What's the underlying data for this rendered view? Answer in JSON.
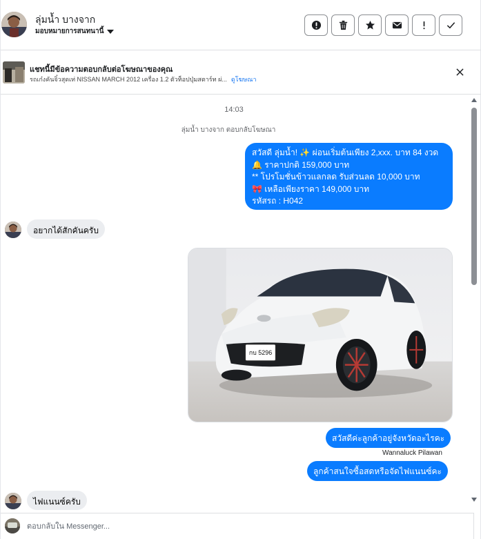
{
  "header": {
    "contact_name": "ลุ่มน้ำ บางจาก",
    "contact_subtitle": "มอบหมายการสนทนานี้",
    "actions": [
      {
        "name": "report-button",
        "icon": "alert-circle-icon"
      },
      {
        "name": "delete-button",
        "icon": "trash-icon"
      },
      {
        "name": "star-button",
        "icon": "star-icon"
      },
      {
        "name": "mark-unread-button",
        "icon": "envelope-icon"
      },
      {
        "name": "flag-button",
        "icon": "exclamation-icon"
      },
      {
        "name": "mark-done-button",
        "icon": "checkmark-icon"
      }
    ]
  },
  "ad_banner": {
    "title": "แชทนี้มีข้อความตอบกลับต่อโฆษณาของคุณ",
    "text": "รถเก๋งคันจิ๋วสุดเท่ NISSAN MARCH 2012 เครื่อง 1.2 ตัวท็อปปุ่มสตาร์ท ผ่...",
    "link": "ดูโฆษณา"
  },
  "thread": {
    "timestamp": "14:03",
    "ad_reply_note": "ลุ่มน้ำ บางจาก ตอบกลับโฆษณา",
    "ad_message_lines": [
      "สวัสดี ลุ่มน้ำ! ✨  ผ่อนเริ่มต้นเพียง 2,xxx. บาท 84 งวด",
      "🔔 ราคาปกติ   159,000 บาท",
      "** โปรโมชั่นข้าวแลกลด รับส่วนลด 10,000 บาท",
      "🎀  เหลือเพียงราคา 149,000 บาท",
      " รหัสรถ : H042"
    ],
    "incoming_1": "อยากได้สักคันครับ",
    "photo": {
      "plate_number": "กบ 5296"
    },
    "outgoing_2": "สวัสดีค่ะลูกค้าอยู่จังหวัดอะไรคะ",
    "sender_name": "Wannaluck Pilawan",
    "outgoing_3": "ลูกค้าสนใจซื้อสดหรือจัดไฟแนนซ์คะ",
    "incoming_2": "ไฟแนนซ์ครับ"
  },
  "composer": {
    "placeholder": "ตอบกลับใน Messenger..."
  },
  "colors": {
    "outgoing_bubble": "#0a7cff",
    "incoming_bubble": "#ebedf0",
    "link": "#1877f2"
  }
}
